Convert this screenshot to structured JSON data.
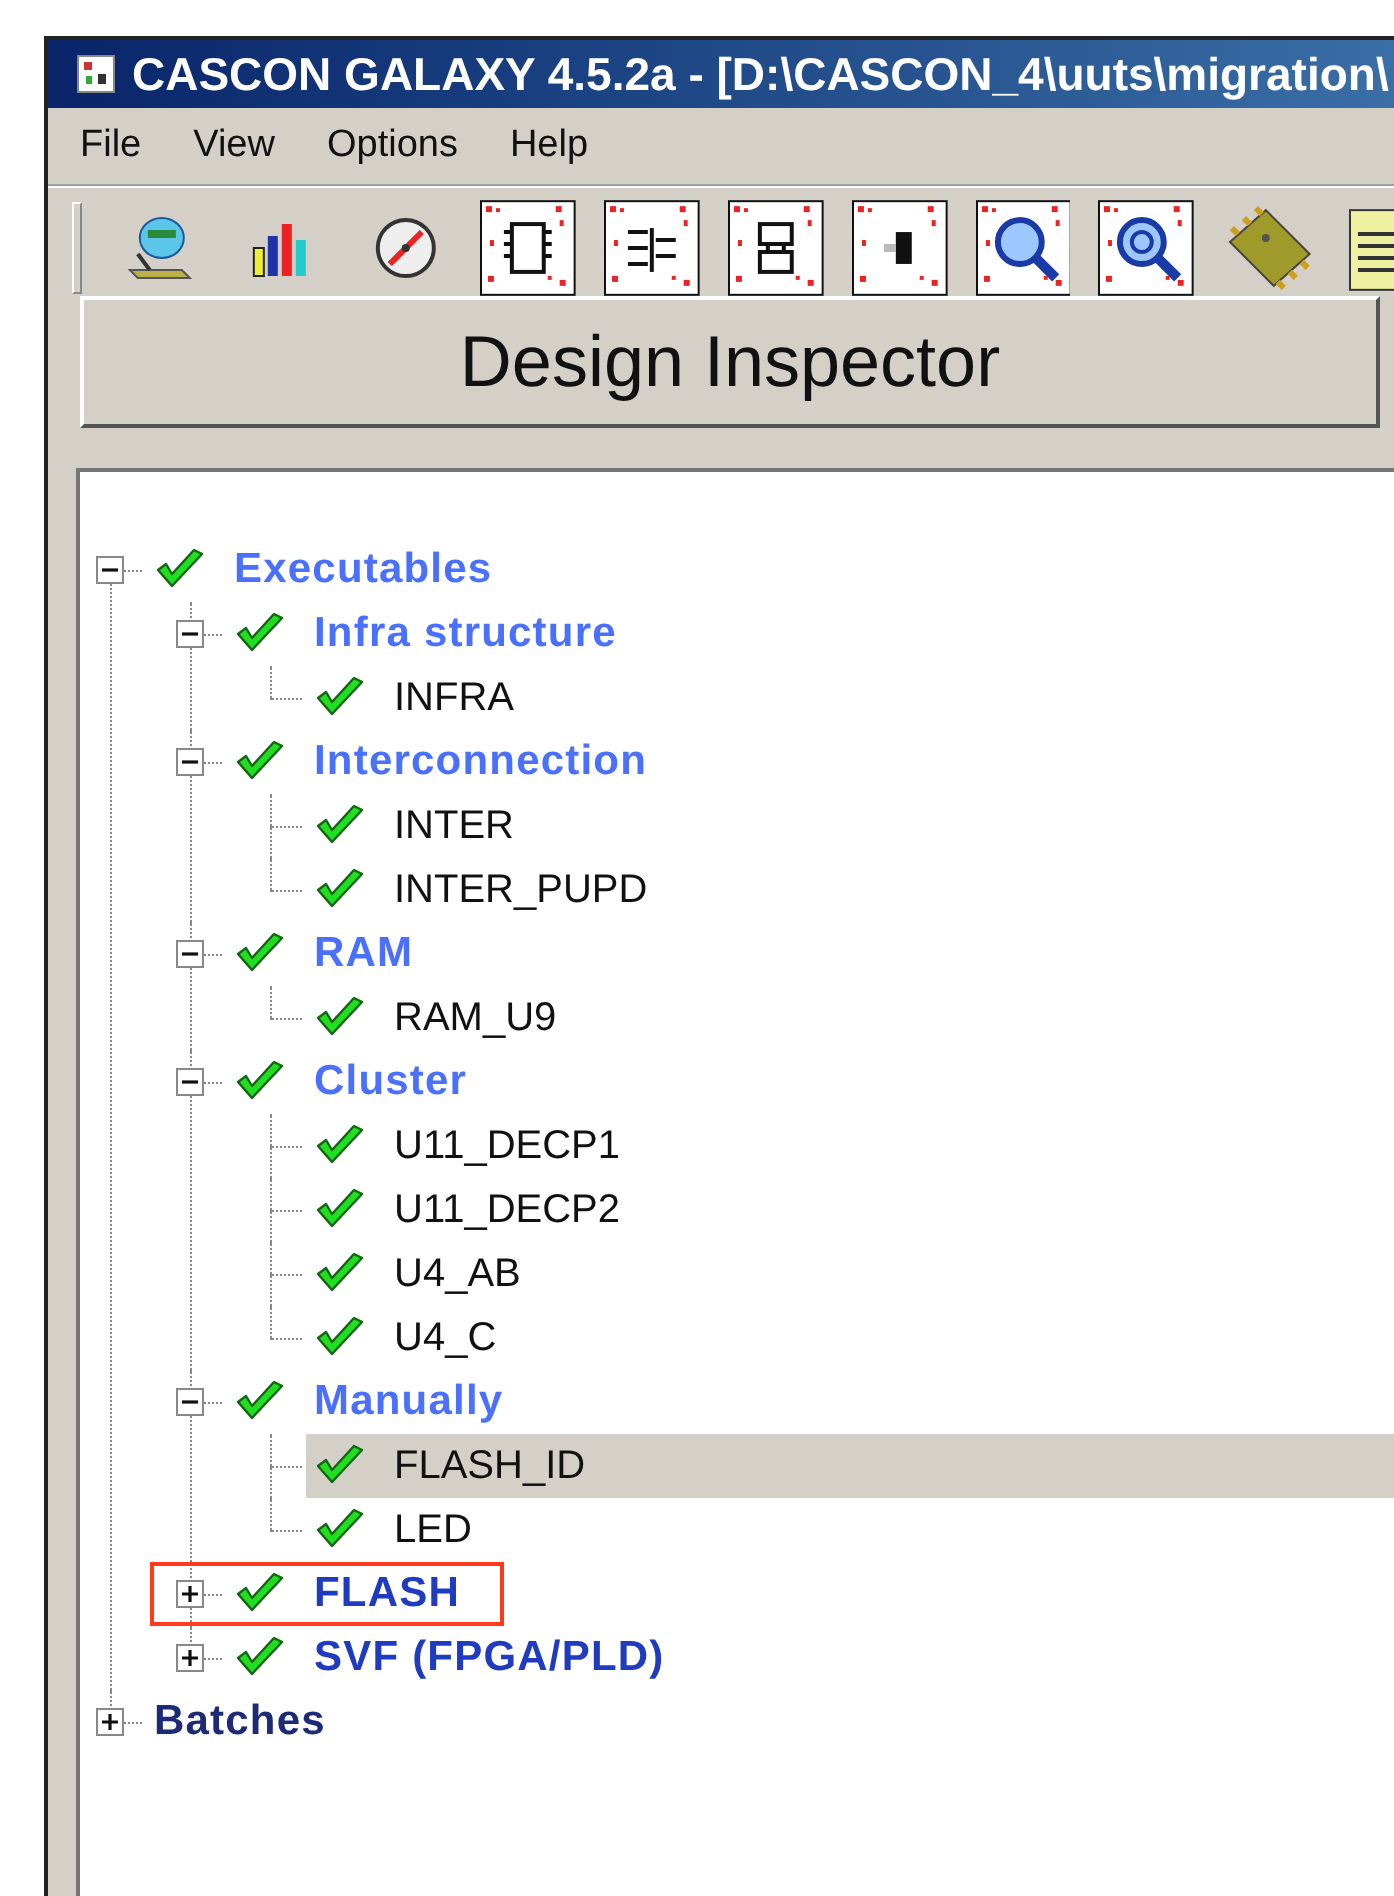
{
  "window": {
    "title": "CASCON GALAXY 4.5.2a - [D:\\CASCON_4\\uuts\\migration\\"
  },
  "menu": [
    {
      "label": "File"
    },
    {
      "label": "View"
    },
    {
      "label": "Options"
    },
    {
      "label": "Help"
    }
  ],
  "inspector_button": {
    "label": "Design Inspector"
  },
  "tree": [
    {
      "label": "Executables",
      "kind": "group",
      "checked": true,
      "expanded": true,
      "selected": false,
      "highlighted": false,
      "children": [
        {
          "label": "Infra structure",
          "kind": "group",
          "checked": true,
          "expanded": true,
          "selected": false,
          "highlighted": false,
          "children": [
            {
              "label": "INFRA",
              "kind": "leaf",
              "checked": true,
              "selected": false,
              "highlighted": false
            }
          ]
        },
        {
          "label": "Interconnection",
          "kind": "group",
          "checked": true,
          "expanded": true,
          "selected": false,
          "highlighted": false,
          "children": [
            {
              "label": "INTER",
              "kind": "leaf",
              "checked": true,
              "selected": false,
              "highlighted": false
            },
            {
              "label": "INTER_PUPD",
              "kind": "leaf",
              "checked": true,
              "selected": false,
              "highlighted": false
            }
          ]
        },
        {
          "label": "RAM",
          "kind": "group",
          "checked": true,
          "expanded": true,
          "selected": false,
          "highlighted": false,
          "children": [
            {
              "label": "RAM_U9",
              "kind": "leaf",
              "checked": true,
              "selected": false,
              "highlighted": false
            }
          ]
        },
        {
          "label": "Cluster",
          "kind": "group",
          "checked": true,
          "expanded": true,
          "selected": false,
          "highlighted": false,
          "children": [
            {
              "label": "U11_DECP1",
              "kind": "leaf",
              "checked": true,
              "selected": false,
              "highlighted": false
            },
            {
              "label": "U11_DECP2",
              "kind": "leaf",
              "checked": true,
              "selected": false,
              "highlighted": false
            },
            {
              "label": "U4_AB",
              "kind": "leaf",
              "checked": true,
              "selected": false,
              "highlighted": false
            },
            {
              "label": "U4_C",
              "kind": "leaf",
              "checked": true,
              "selected": false,
              "highlighted": false
            }
          ]
        },
        {
          "label": "Manually",
          "kind": "group",
          "checked": true,
          "expanded": true,
          "selected": false,
          "highlighted": false,
          "children": [
            {
              "label": "FLASH_ID",
              "kind": "leaf",
              "checked": true,
              "selected": true,
              "highlighted": false
            },
            {
              "label": "LED",
              "kind": "leaf",
              "checked": true,
              "selected": false,
              "highlighted": false
            }
          ]
        },
        {
          "label": "FLASH",
          "kind": "group",
          "checked": true,
          "expanded": false,
          "selected": false,
          "highlighted": true
        },
        {
          "label": "SVF (FPGA/PLD)",
          "kind": "group",
          "checked": true,
          "expanded": false,
          "selected": false,
          "highlighted": false
        }
      ]
    },
    {
      "label": "Batches",
      "kind": "group",
      "checked": false,
      "expanded": false,
      "selected": false,
      "highlighted": false
    }
  ]
}
